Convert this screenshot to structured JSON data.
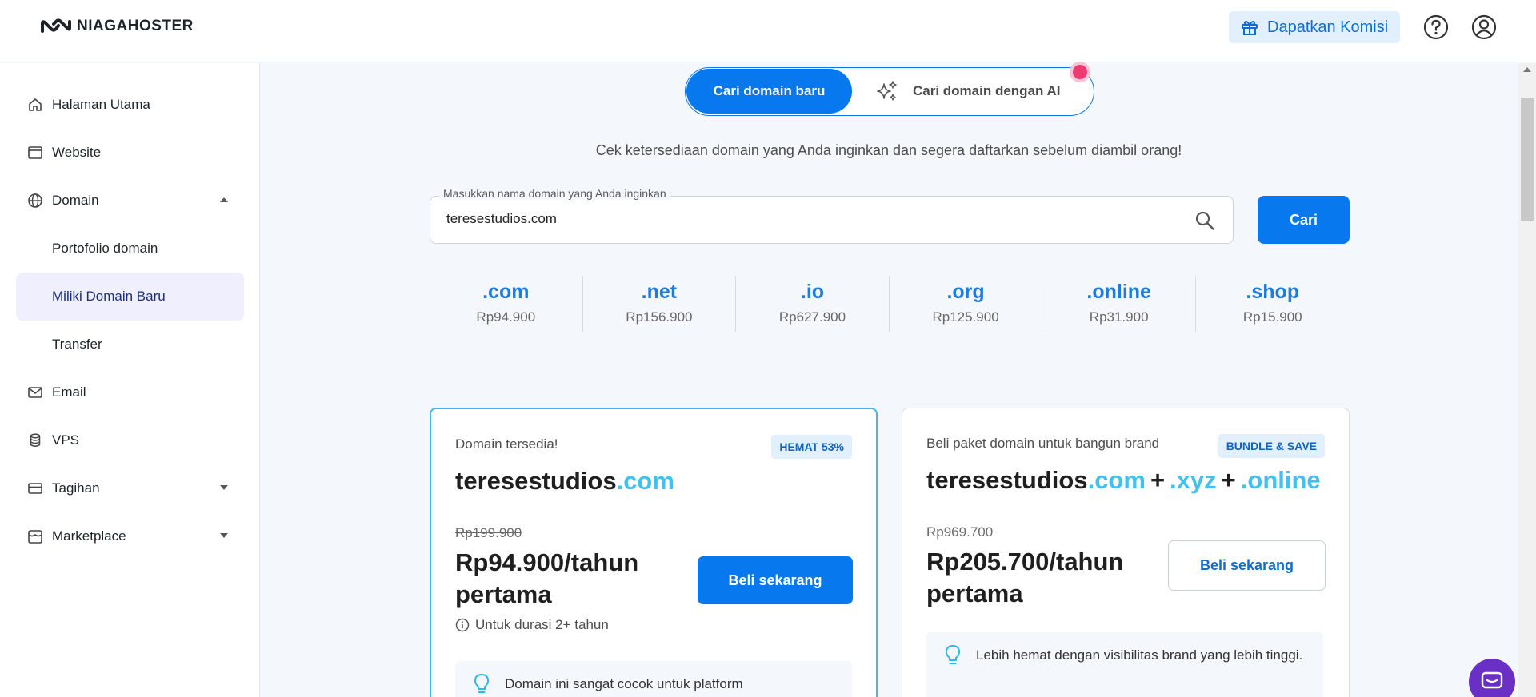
{
  "header": {
    "logo_text": "NIAGAHOSTER",
    "promo_label": "Dapatkan Komisi"
  },
  "sidebar": {
    "items": [
      {
        "label": "Halaman Utama",
        "icon": "home-icon"
      },
      {
        "label": "Website",
        "icon": "browser-icon"
      },
      {
        "label": "Domain",
        "icon": "globe-icon",
        "expanded": true
      },
      {
        "label": "Portofolio domain"
      },
      {
        "label": "Miliki Domain Baru",
        "active": true
      },
      {
        "label": "Transfer"
      },
      {
        "label": "Email",
        "icon": "mail-icon"
      },
      {
        "label": "VPS",
        "icon": "database-icon"
      },
      {
        "label": "Tagihan",
        "icon": "card-icon",
        "expanded": false
      },
      {
        "label": "Marketplace",
        "icon": "store-icon",
        "expanded": false
      }
    ]
  },
  "search_mode": {
    "active_label": "Cari domain baru",
    "ai_label": "Cari domain dengan AI"
  },
  "subtitle": "Cek ketersediaan domain yang Anda inginkan dan segera daftarkan sebelum diambil orang!",
  "search": {
    "label": "Masukkan nama domain yang Anda inginkan",
    "value": "teresestudios.com",
    "button_label": "Cari"
  },
  "tlds": [
    {
      "name": ".com",
      "price": "Rp94.900"
    },
    {
      "name": ".net",
      "price": "Rp156.900"
    },
    {
      "name": ".io",
      "price": "Rp627.900"
    },
    {
      "name": ".org",
      "price": "Rp125.900"
    },
    {
      "name": ".online",
      "price": "Rp31.900"
    },
    {
      "name": ".shop",
      "price": "Rp15.900"
    }
  ],
  "card_available": {
    "status": "Domain tersedia!",
    "badge": "HEMAT 53%",
    "domain_base": "teresestudios",
    "domain_ext": ".com",
    "old_price": "Rp199.900",
    "new_price": "Rp94.900/tahun pertama",
    "buy_label": "Beli sekarang",
    "duration_note": "Untuk durasi 2+ tahun",
    "tip": "Domain ini sangat cocok untuk platform"
  },
  "card_bundle": {
    "status": "Beli paket domain untuk bangun brand",
    "badge": "BUNDLE & SAVE",
    "domain_base": "teresestudios",
    "ext1": ".com",
    "plus1": "+",
    "ext2": ".xyz",
    "plus2": "+",
    "ext3": ".online",
    "old_price": "Rp969.700",
    "new_price": "Rp205.700/tahun pertama",
    "buy_label": "Beli sekarang",
    "tip": "Lebih hemat dengan visibilitas brand yang lebih tinggi."
  },
  "colors": {
    "primary": "#0878ee",
    "accent_ext": "#43c1ee",
    "active_nav_bg": "#f0effd",
    "notification_dot": "#ee3a72",
    "chat_bubble": "#6a2fc4"
  }
}
